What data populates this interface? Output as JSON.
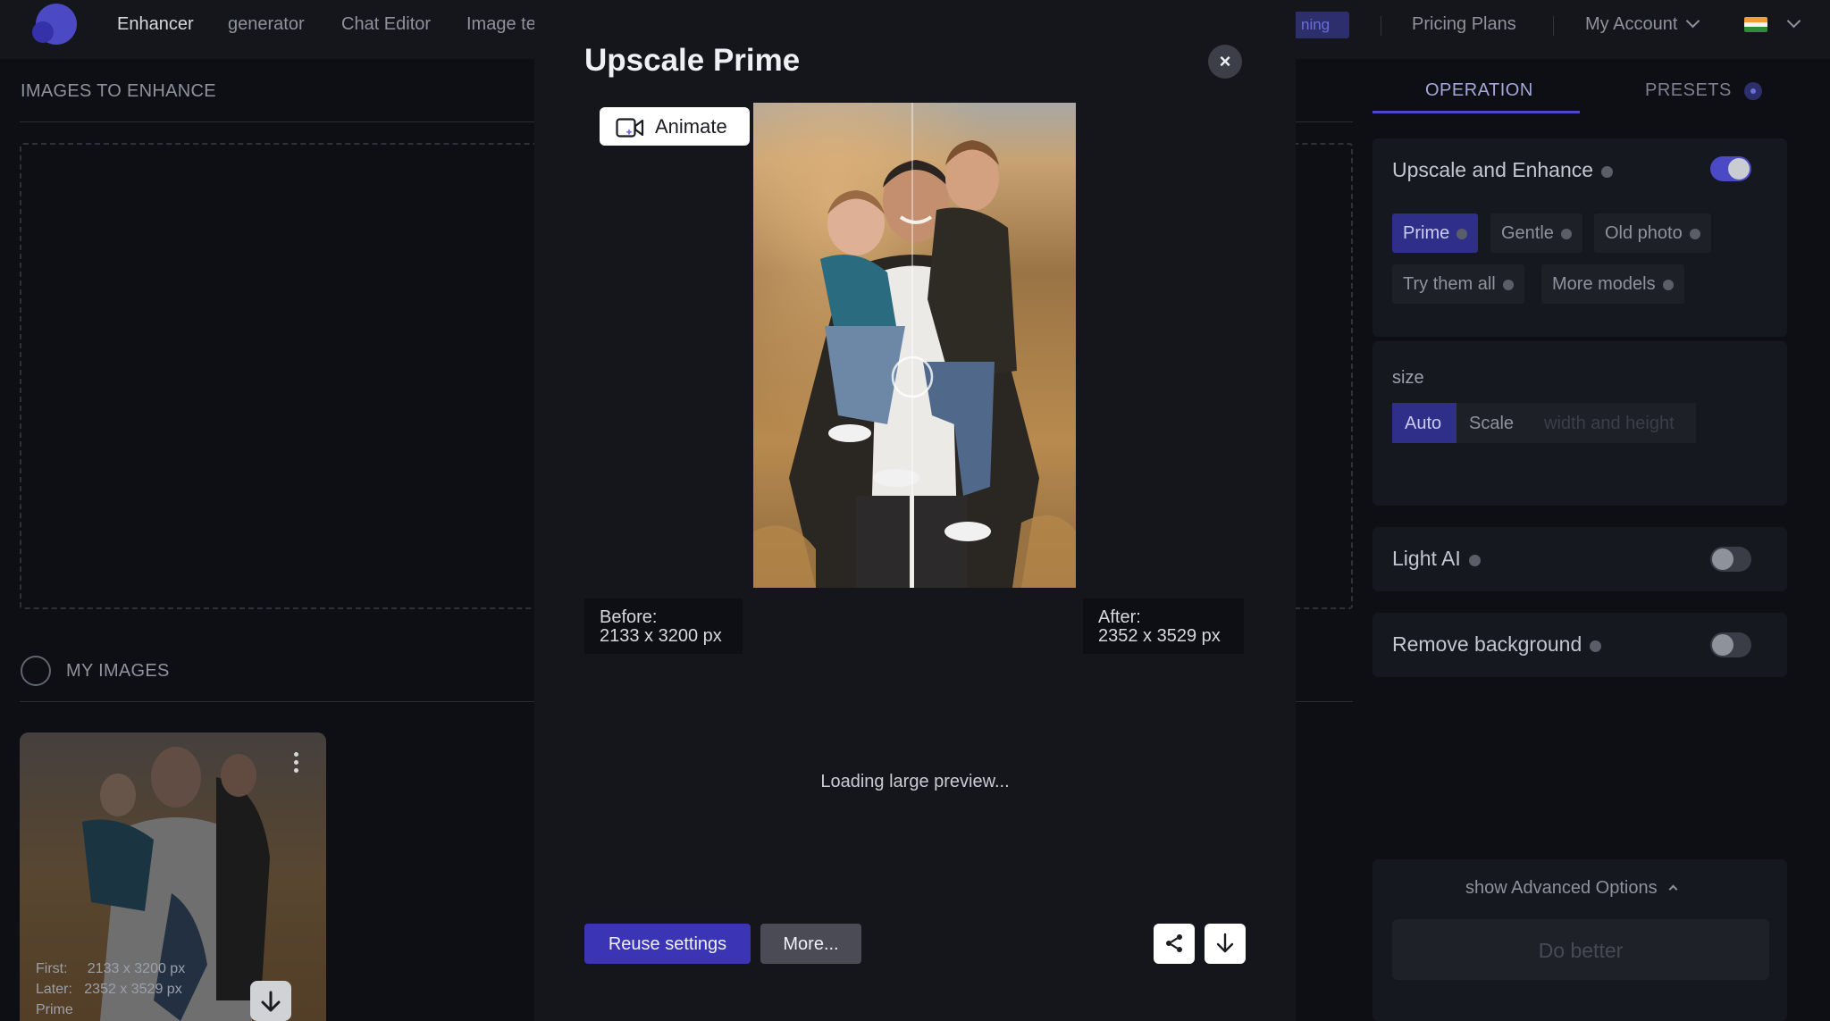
{
  "nav": {
    "items": [
      "Enhancer",
      "generator",
      "Chat Editor",
      "Image tе"
    ],
    "training_badge": "ning",
    "pricing": "Pricing Plans",
    "account": "My Account",
    "flag": "india-flag-icon"
  },
  "left": {
    "images_to_enhance": "IMAGES TO ENHANCE",
    "my_images": "MY IMAGES",
    "thumb": {
      "first_label": "First:",
      "first_value": "2133 x 3200 px",
      "later_label": "Later:",
      "later_value": "2352 x 3529 px",
      "model": "Prime"
    }
  },
  "right": {
    "tabs": [
      "OPERATION",
      "PRESETS"
    ],
    "upscale": {
      "title": "Upscale and Enhance",
      "enabled": true,
      "models": [
        "Prime",
        "Gentle",
        "Old photo",
        "Try them all",
        "More models"
      ],
      "selected": "Prime"
    },
    "size": {
      "label": "size",
      "options": [
        "Auto",
        "Scale",
        "width and height"
      ],
      "selected": "Auto"
    },
    "light_ai": {
      "title": "Light AI",
      "enabled": false
    },
    "remove_bg": {
      "title": "Remove background",
      "enabled": false
    },
    "advanced": "show Advanced Options",
    "do_better": "Do better"
  },
  "modal": {
    "title": "Upscale Prime",
    "close": "×",
    "animate": "Animate",
    "before_label": "Before:",
    "before_value": "2133 x 3200 px",
    "after_label": "After:",
    "after_value": "2352 x 3529 px",
    "loading": "Loading large preview...",
    "reuse": "Reuse settings",
    "more": "More...",
    "comparison_position": 0.5
  },
  "colors": {
    "accent": "#4b49c4",
    "background": "#0d0f14",
    "panel": "#14161c"
  }
}
